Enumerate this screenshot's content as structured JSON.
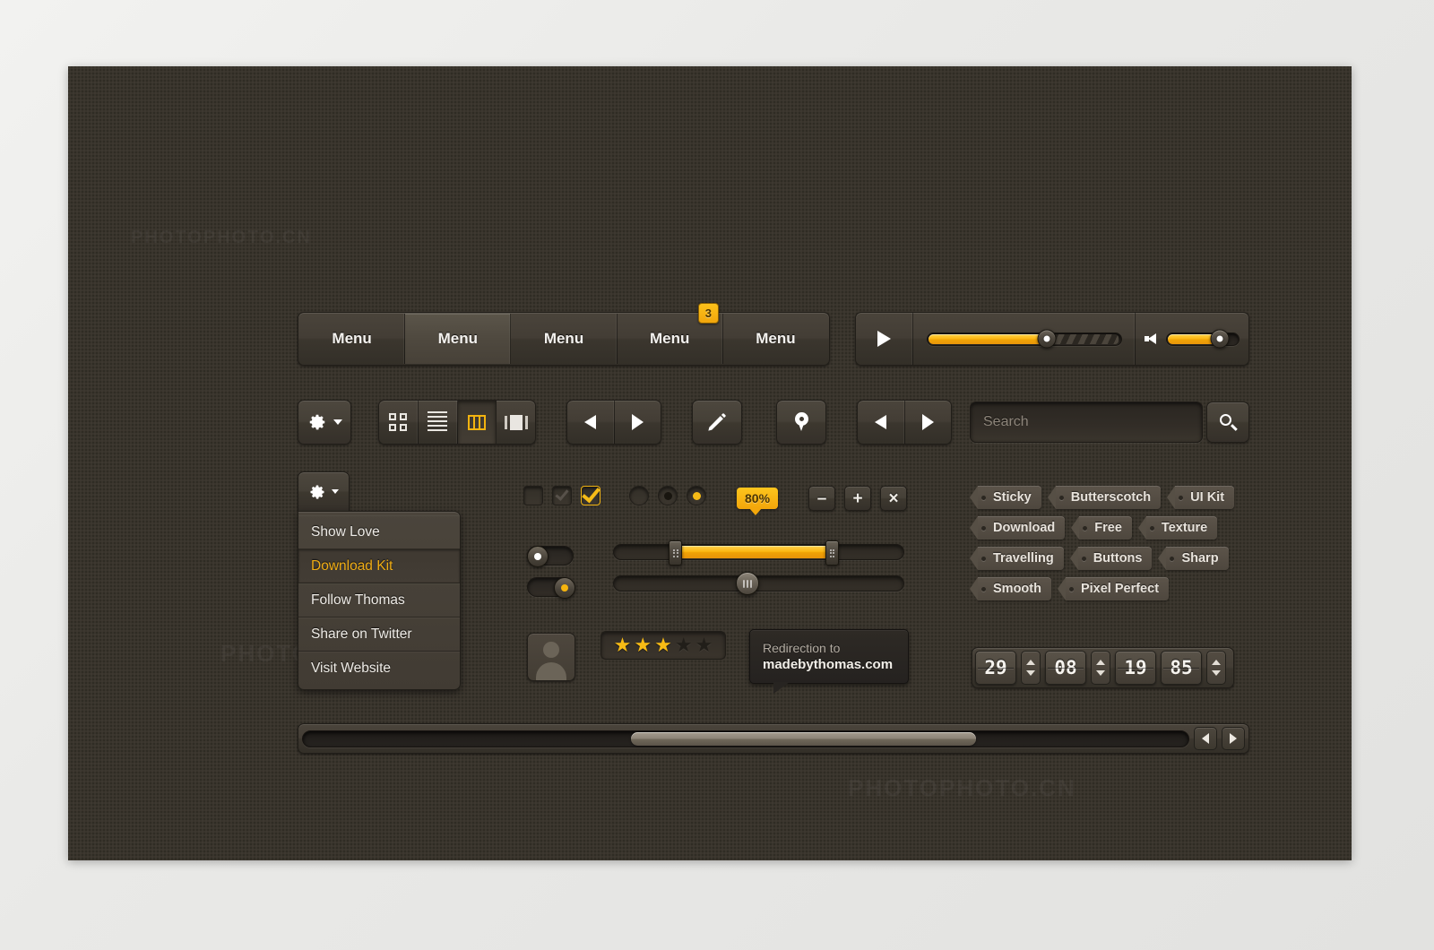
{
  "canvas": {
    "background": "#39342c",
    "accent": "#f2a50a"
  },
  "menubar": {
    "items": [
      {
        "label": "Menu",
        "active": false,
        "badge": null
      },
      {
        "label": "Menu",
        "active": true,
        "badge": null
      },
      {
        "label": "Menu",
        "active": false,
        "badge": null
      },
      {
        "label": "Menu",
        "active": false,
        "badge": "3"
      },
      {
        "label": "Menu",
        "active": false,
        "badge": null
      }
    ]
  },
  "player": {
    "play_icon": "play-icon",
    "progress_percent": 62,
    "buffer_percent": 80,
    "volume_icon": "speaker-icon",
    "volume_percent": 72
  },
  "toolbar": {
    "gear_label": "gear-dropdown-button",
    "segmented": [
      {
        "icon": "grid-view-icon",
        "active": false
      },
      {
        "icon": "list-view-icon",
        "active": false
      },
      {
        "icon": "column-view-icon",
        "active": true
      },
      {
        "icon": "coverflow-view-icon",
        "active": false
      }
    ],
    "prev_icon": "arrow-left-icon",
    "next_icon": "arrow-right-icon",
    "edit_icon": "pencil-icon",
    "location_icon": "map-pin-icon",
    "pager_prev_icon": "arrow-left-icon",
    "pager_next_icon": "arrow-right-icon"
  },
  "search": {
    "placeholder": "Search",
    "value": "",
    "button_icon": "search-icon"
  },
  "dropdown": {
    "trigger_icon": "gear-icon",
    "items": [
      {
        "label": "Show Love",
        "selected": false
      },
      {
        "label": "Download Kit",
        "selected": true
      },
      {
        "label": "Follow Thomas",
        "selected": false
      },
      {
        "label": "Share on Twitter",
        "selected": false
      },
      {
        "label": "Visit Website",
        "selected": false
      }
    ]
  },
  "checkboxes": [
    {
      "state": "unchecked"
    },
    {
      "state": "checked-dim"
    },
    {
      "state": "checked-amber"
    }
  ],
  "radios": [
    {
      "state": "empty"
    },
    {
      "state": "dark-dot"
    },
    {
      "state": "amber-dot"
    }
  ],
  "percent_tooltip": {
    "value": "80%"
  },
  "mini_buttons": [
    {
      "icon": "minus-icon",
      "label": "–"
    },
    {
      "icon": "plus-icon",
      "label": "+"
    },
    {
      "icon": "close-icon",
      "label": "×"
    }
  ],
  "tags": [
    "Sticky",
    "Butterscotch",
    "UI Kit",
    "Download",
    "Free",
    "Texture",
    "Travelling",
    "Buttons",
    "Sharp",
    "Smooth",
    "Pixel Perfect"
  ],
  "toggles": [
    {
      "state": "off",
      "dot_color": "#ffffff"
    },
    {
      "state": "on",
      "dot_color": "#f5b40e"
    }
  ],
  "range_slider": {
    "start_percent": 23,
    "end_percent": 75
  },
  "single_slider": {
    "value_percent": 46
  },
  "avatar": {
    "icon": "user-avatar-icon"
  },
  "rating": {
    "value": 3,
    "max": 5
  },
  "tooltip": {
    "line1": "Redirection to",
    "line2": "madebythomas.com"
  },
  "steppers": [
    {
      "value": "29"
    },
    {
      "value": "08"
    },
    {
      "value": "19"
    },
    {
      "value": "85"
    }
  ],
  "scrollbar": {
    "thumb_start_percent": 37,
    "thumb_width_percent": 39,
    "left_arrow_icon": "arrow-left-icon",
    "right_arrow_icon": "arrow-right-icon"
  },
  "watermark": {
    "text": "PHOTOPHOTO.CN"
  }
}
